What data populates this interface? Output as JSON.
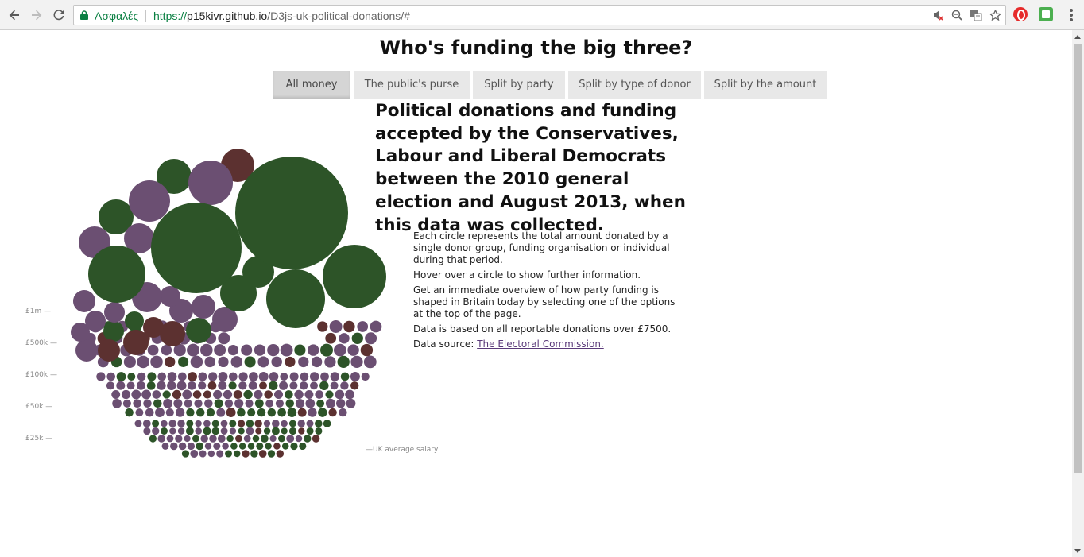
{
  "browser": {
    "secure_label": "Ασφαλές",
    "url_scheme": "https://",
    "url_host": "p15kivr.github.io",
    "url_path": "/D3js-uk-political-donations/#",
    "icons": [
      "back-icon",
      "forward-icon",
      "reload-icon",
      "lock-icon",
      "blocked-icon",
      "zoom-out-icon",
      "translate-icon",
      "star-icon",
      "opera-extension-icon",
      "green-extension-icon",
      "menu-icon"
    ]
  },
  "page": {
    "title": "Who's funding the big three?",
    "tabs": [
      {
        "label": "All money",
        "active": true
      },
      {
        "label": "The public's purse",
        "active": false
      },
      {
        "label": "Split by party",
        "active": false
      },
      {
        "label": "Split by type of donor",
        "active": false
      },
      {
        "label": "Split by the amount",
        "active": false
      }
    ],
    "headline": "Political donations and funding accepted by the Conservatives, Labour and Liberal Democrats between the 2010 general election and August 2013, when this data was collected.",
    "description": {
      "p1": "Each circle represents the total amount donated by a single donor group, funding organisation or individual during that period.",
      "p2": "Hover over a circle to show further information.",
      "p3": "Get an immediate overview of how party funding is shaped in Britain today by selecting one of the options at the top of the page.",
      "p4": "Data is based on all reportable donations over £7500.",
      "p5_prefix": "Data source: ",
      "p5_link": "The Electoral Commission."
    },
    "axis": {
      "ticks": [
        "£1m —",
        "£500k —",
        "£100k —",
        "£50k —",
        "£25k —"
      ],
      "salary_label": "—UK average salary"
    }
  },
  "colors": {
    "conservative": "#6b4f72",
    "labour": "#2d5428",
    "libdem": "#5c3130",
    "tab_bg": "#e8e8e8",
    "tab_active_bg": "#d5d5d5"
  }
}
